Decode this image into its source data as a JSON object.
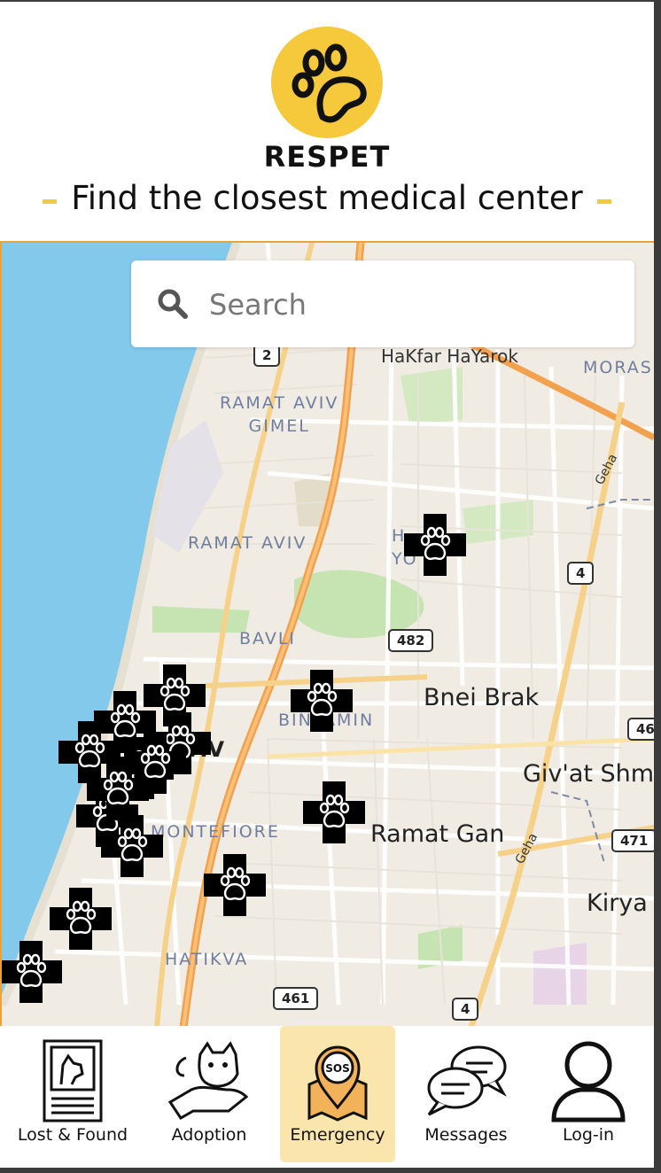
{
  "header": {
    "brand": "RESPET",
    "tagline": "Find the closest medical center",
    "accent_color": "#f5c93b"
  },
  "search": {
    "placeholder": "Search",
    "value": ""
  },
  "map": {
    "places": {
      "hakfar": "HaKfar HaYarok",
      "moras": "MORAS",
      "ramat_aviv_gimel": "RAMAT AVIV\nGIMEL",
      "ramat_aviv": "RAMAT AVIV",
      "bavli": "BAVLI",
      "bnei_brak": "Bnei Brak",
      "binyamin": "BINYAMIN",
      "givat": "Giv'at Shm",
      "ramat_gan": "Ramat Gan",
      "montefiore": "MONTEFIORE",
      "kiryat": "Kirya",
      "hatikva": "HATIKVA",
      "aviv": "AVIV",
      "h_yoel": "H\nYO"
    },
    "shields": {
      "r2": "2",
      "r4a": "4",
      "r482": "482",
      "r46": "46",
      "r471": "471",
      "r461": "461",
      "r4b": "4"
    },
    "roads": {
      "geha1": "Geha",
      "geha2": "Geha"
    },
    "markers": [
      {
        "name": "vet-marker"
      },
      {
        "name": "vet-marker"
      },
      {
        "name": "vet-marker"
      },
      {
        "name": "vet-marker"
      },
      {
        "name": "vet-marker"
      },
      {
        "name": "vet-marker"
      },
      {
        "name": "vet-marker"
      },
      {
        "name": "vet-marker"
      },
      {
        "name": "vet-marker"
      },
      {
        "name": "vet-marker"
      },
      {
        "name": "vet-marker"
      },
      {
        "name": "vet-marker"
      },
      {
        "name": "vet-marker"
      },
      {
        "name": "vet-marker"
      },
      {
        "name": "vet-marker"
      }
    ]
  },
  "nav": {
    "items": [
      {
        "label": "Lost & Found",
        "icon": "lost-found-icon"
      },
      {
        "label": "Adoption",
        "icon": "adoption-icon"
      },
      {
        "label": "Emergency",
        "icon": "emergency-sos-icon",
        "active": true
      },
      {
        "label": "Messages",
        "icon": "messages-icon"
      },
      {
        "label": "Log-in",
        "icon": "user-icon"
      }
    ],
    "active_color": "#fae6ac"
  }
}
